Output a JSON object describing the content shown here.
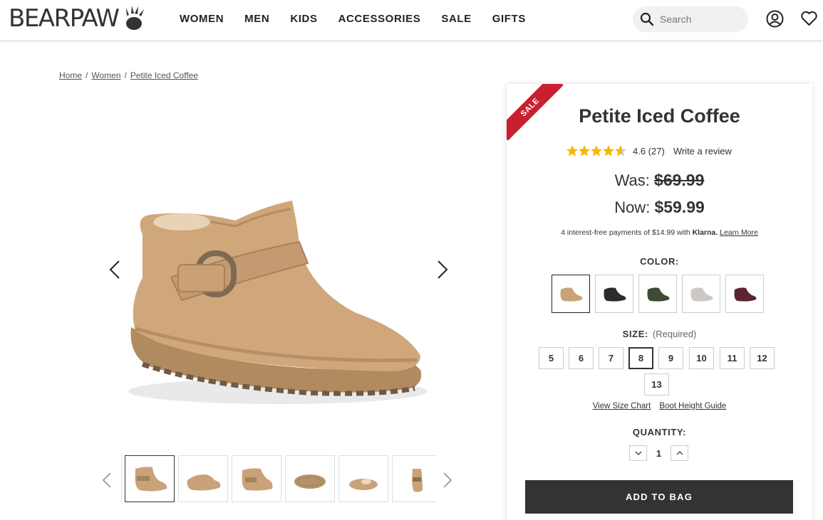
{
  "header": {
    "logo": "BEARPAW",
    "nav": [
      "WOMEN",
      "MEN",
      "KIDS",
      "ACCESSORIES",
      "SALE",
      "GIFTS"
    ],
    "search_placeholder": "Search"
  },
  "breadcrumb": [
    "Home",
    "Women",
    "Petite Iced Coffee"
  ],
  "product": {
    "badge": "SALE",
    "title": "Petite Iced Coffee",
    "rating": 4.6,
    "rating_text": "4.6 (27)",
    "review_link": "Write a review",
    "was_label": "Was: ",
    "was_price": "$69.99",
    "now_label": "Now: ",
    "now_price": "$59.99",
    "klarna_text": "4 interest-free payments of $14.99 with ",
    "klarna_brand": "Klarna.",
    "klarna_link": "Learn More",
    "color_label": "COLOR:",
    "colors": [
      {
        "name": "chestnut",
        "hex": "#c9a27a"
      },
      {
        "name": "black",
        "hex": "#2c2c2c"
      },
      {
        "name": "olive",
        "hex": "#3f4a35"
      },
      {
        "name": "gray fog",
        "hex": "#cfc8c2"
      },
      {
        "name": "wine",
        "hex": "#5b2430"
      }
    ],
    "selected_color_index": 0,
    "size_label": "SIZE:",
    "size_required": "(Required)",
    "sizes": [
      "5",
      "6",
      "7",
      "8",
      "9",
      "10",
      "11",
      "12",
      "13"
    ],
    "selected_size": "8",
    "size_chart_link": "View Size Chart",
    "boot_height_link": "Boot Height Guide",
    "quantity_label": "QUANTITY:",
    "quantity": "1",
    "add_to_bag": "ADD TO BAG"
  },
  "colors": {
    "accent_sale": "#c8202f",
    "button_bg": "#333333",
    "star": "#f5b800",
    "shoe": "#c9a27a"
  }
}
